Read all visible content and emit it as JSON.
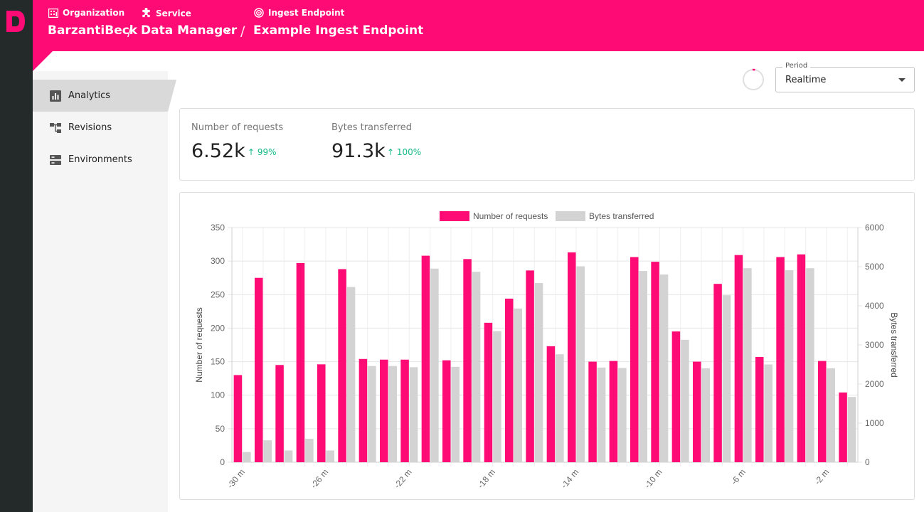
{
  "colors": {
    "brand": "#ff0b75",
    "rail": "#232a29",
    "bytes": "#d3d3d3",
    "positive": "#12b886"
  },
  "breadcrumb": {
    "organization": {
      "label": "Organization",
      "value": "BarzantiBeck",
      "icon": "building-icon"
    },
    "service": {
      "label": "Service",
      "value": "Data Manager",
      "icon": "puzzle-icon"
    },
    "endpoint": {
      "label": "Ingest Endpoint",
      "value": "Example Ingest Endpoint",
      "icon": "target-icon"
    }
  },
  "sidebar": {
    "items": [
      {
        "label": "Analytics",
        "icon": "bar-chart-icon",
        "active": true
      },
      {
        "label": "Revisions",
        "icon": "tree-icon",
        "active": false
      },
      {
        "label": "Environments",
        "icon": "server-icon",
        "active": false
      }
    ]
  },
  "period": {
    "legend": "Period",
    "value": "Realtime"
  },
  "stats": {
    "requests": {
      "label": "Number of requests",
      "value": "6.52k",
      "delta": "99%"
    },
    "bytes": {
      "label": "Bytes transferred",
      "value": "91.3k",
      "delta": "100%"
    }
  },
  "chart_data": {
    "type": "bar",
    "legend_position": "top",
    "grid": true,
    "x_tick_labels": [
      "-30 m",
      "-26 m",
      "-22 m",
      "-18 m",
      "-14 m",
      "-10 m",
      "-6 m",
      "-2 m"
    ],
    "y_left": {
      "label": "Number of requests",
      "range": [
        0,
        350
      ],
      "ticks": [
        0,
        50,
        100,
        150,
        200,
        250,
        300,
        350
      ]
    },
    "y_right": {
      "label": "Bytes transferred",
      "range": [
        0,
        6000
      ],
      "ticks": [
        0,
        1000,
        2000,
        3000,
        4000,
        5000,
        6000
      ]
    },
    "series": [
      {
        "name": "Number of requests",
        "axis": "left",
        "color": "#ff0b75",
        "values": [
          130,
          275,
          145,
          297,
          146,
          288,
          154,
          153,
          153,
          308,
          152,
          303,
          208,
          244,
          286,
          173,
          313,
          150,
          151,
          306,
          299,
          195,
          150,
          266,
          309,
          157,
          306,
          310,
          151,
          104
        ]
      },
      {
        "name": "Bytes transferred",
        "axis": "right",
        "color": "#d3d3d3",
        "values": [
          260,
          560,
          300,
          600,
          300,
          4480,
          2460,
          2460,
          2430,
          4950,
          2440,
          4870,
          3350,
          3930,
          4580,
          2760,
          5010,
          2420,
          2410,
          4890,
          4800,
          3130,
          2400,
          4270,
          4960,
          2500,
          4910,
          4960,
          2400,
          1670
        ]
      }
    ]
  }
}
